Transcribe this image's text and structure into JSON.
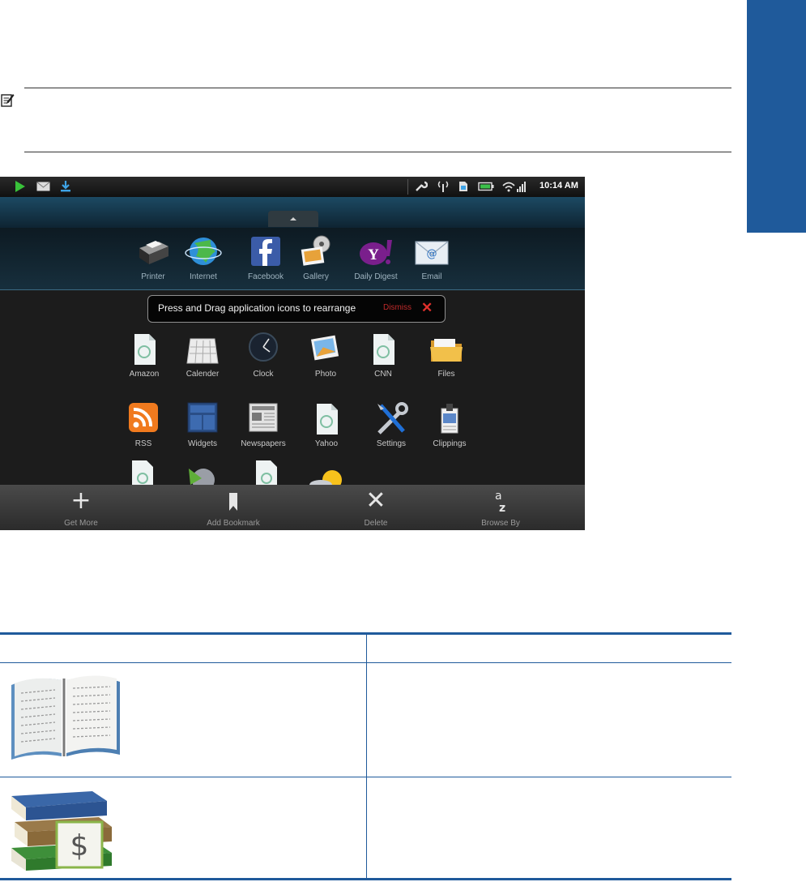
{
  "colors": {
    "side_tab": "#1f5a9b",
    "table_rule": "#1f5a9b",
    "status_bg": "#151515"
  },
  "note": {
    "icon": "note-icon"
  },
  "device": {
    "status_bar": {
      "left_icons": [
        "play-icon",
        "mail-icon",
        "download-icon"
      ],
      "right_icons": [
        "wrench-icon",
        "antenna-icon",
        "sim-icon",
        "battery-icon",
        "wifi-icon"
      ],
      "time": "10:14 AM"
    },
    "dock_apps": [
      "Printer",
      "Internet",
      "Facebook",
      "Gallery",
      "Daily Digest",
      "Email"
    ],
    "toast": {
      "message": "Press and Drag application icons to rearrange",
      "dismiss": "Dismiss"
    },
    "apps_row1": [
      "Amazon",
      "Calender",
      "Clock",
      "Photo",
      "CNN",
      "Files"
    ],
    "apps_row2": [
      "RSS",
      "Widgets",
      "Newspapers",
      "Yahoo",
      "Settings",
      "Clippings"
    ],
    "actions": [
      {
        "label": "Get More",
        "icon": "plus-icon",
        "glyph": "+"
      },
      {
        "label": "Add Bookmark",
        "icon": "bookmark-icon",
        "glyph": ""
      },
      {
        "label": "Delete",
        "icon": "delete-x-icon",
        "glyph": "✕"
      },
      {
        "label": "Browse By",
        "icon": "sort-az-icon",
        "glyph": ""
      }
    ]
  },
  "table": {
    "rows": [
      {
        "icon": "open-book-icon"
      },
      {
        "icon": "bookstore-icon"
      }
    ]
  }
}
